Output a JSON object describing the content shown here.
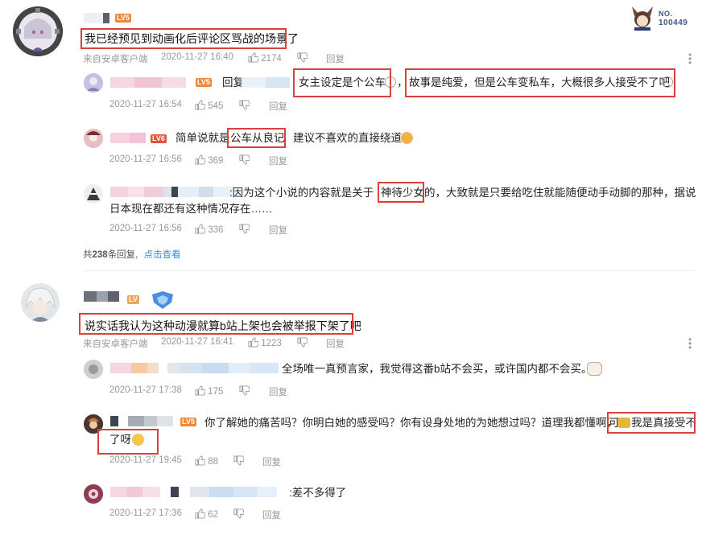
{
  "badge": {
    "label": "NO.",
    "number": "100449"
  },
  "comments": [
    {
      "level": "LV5",
      "text": "我已经预见到动画化后评论区骂战的场景了",
      "client": "来自安卓客户端",
      "time": "2020-11-27 16:40",
      "likes": "2174",
      "reply_label": "回复",
      "replies": [
        {
          "level": "LV5",
          "prefix": "回复",
          "segments": [
            "女主设定是个公车",
            "，",
            "故事是纯爱，但是公车变私车，大概很多人接受不了吧"
          ],
          "time": "2020-11-27 16:54",
          "likes": "545",
          "reply_label": "回复"
        },
        {
          "level": "LV6",
          "segments": [
            "简单说就是",
            "公车从良记",
            "建议不喜欢的直接绕道"
          ],
          "time": "2020-11-27 16:56",
          "likes": "369",
          "reply_label": "回复"
        },
        {
          "segments": [
            ":因为这个小说的内容就是关于",
            "神待少女",
            "的，大致就是只要给吃住就能随便动手动脚的那种，据说",
            "日本现在都还有这种情况存在……"
          ],
          "time": "2020-11-27 16:56",
          "likes": "336",
          "reply_label": "回复"
        }
      ],
      "more": {
        "prefix": "共",
        "count": "238",
        "suffix": "条回复,",
        "link": "点击查看"
      }
    },
    {
      "level": "LV",
      "text": "说实话我认为这种动漫就算b站上架也会被举报下架了吧",
      "client": "来自安卓客户端",
      "time": "2020-11-27 16:41",
      "likes": "1223",
      "reply_label": "回复",
      "replies": [
        {
          "segments": [
            "全场唯一真预言家，我觉得这番b站不会买，或许国内都不会买。"
          ],
          "time": "2020-11-27 17:38",
          "likes": "175",
          "reply_label": "回复"
        },
        {
          "level": "LV5",
          "segments": [
            "你了解她的痛苦吗？你明白她的感受吗？你有设身处地的为她想过吗？道理我都懂啊，",
            "可",
            "我是真接受不",
            "了呀"
          ],
          "time": "2020-11-27 19:45",
          "likes": "88",
          "reply_label": "回复"
        },
        {
          "segments": [
            ":差不多得了"
          ],
          "time": "2020-11-27 17:36",
          "likes": "62",
          "reply_label": "回复"
        }
      ]
    }
  ],
  "colors": {
    "highlight_box": "#d9413d",
    "link": "#3a8fd8",
    "meta": "#999999",
    "level_orange": "#f0883a",
    "level_red": "#e0533f"
  }
}
